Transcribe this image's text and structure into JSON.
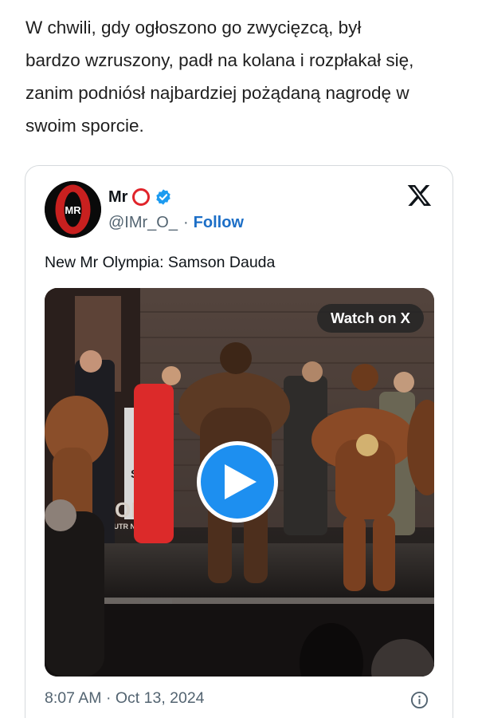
{
  "article": {
    "lines": [
      "W chwili, gdy ogłoszono go zwycięzcą, był",
      "bardzo wzruszony, padł na kolana i rozpłakał się,",
      "zanim podniósł najbardziej pożądaną nagrodę w",
      "swoim sporcie."
    ]
  },
  "tweet": {
    "avatar": {
      "initials": "MR"
    },
    "user": {
      "name": "Mr",
      "handle": "@IMr_O_",
      "separator": "·",
      "follow_label": "Follow"
    },
    "text": "New Mr Olympia: Samson Dauda",
    "video": {
      "watch_label": "Watch on X",
      "banner_text_1": "SY",
      "banner_text_2": "ORE",
      "banner_text_3": "NUTR   NALS"
    },
    "timestamp": "8:07 AM · Oct 13, 2024"
  },
  "colors": {
    "link": "#1d6fc7",
    "play": "#1d8ff0",
    "brand_red": "#e0242b",
    "verified": "#1d9bf0",
    "muted": "#536471"
  },
  "icons": [
    "ring-icon",
    "verified-badge-icon",
    "x-logo-icon",
    "play-icon",
    "info-icon"
  ]
}
